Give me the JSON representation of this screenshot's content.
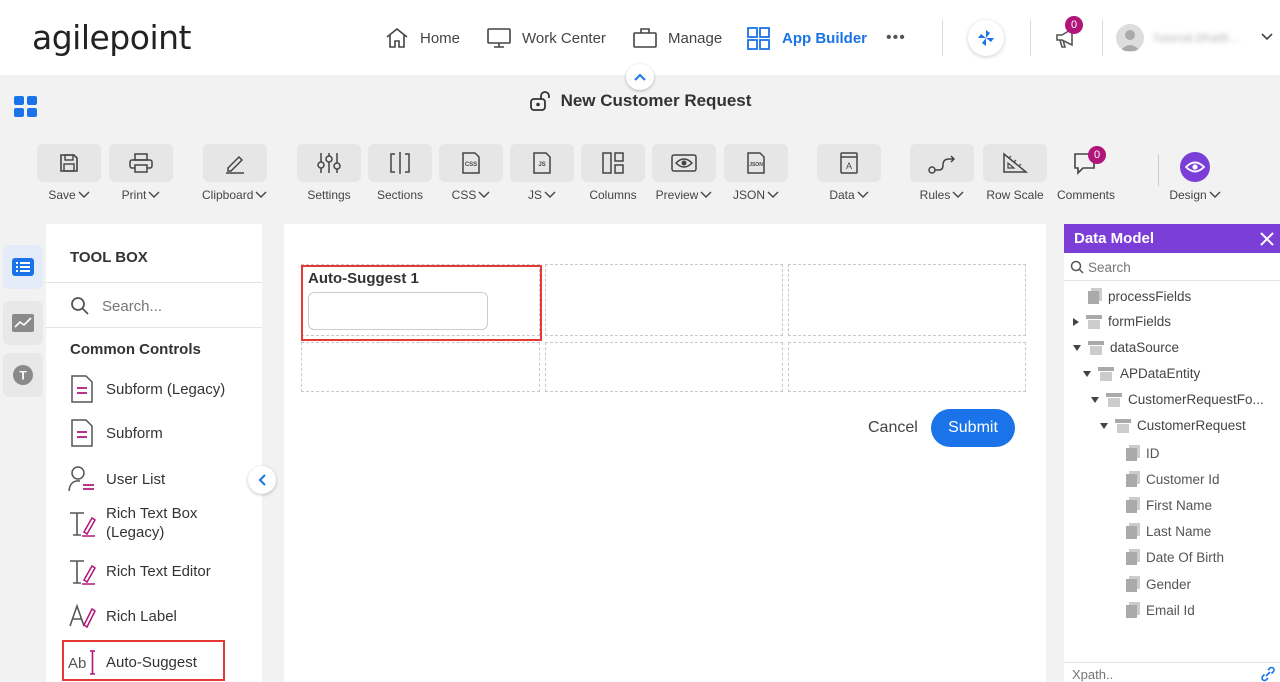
{
  "brand": {
    "logo_text": "agilepoint"
  },
  "nav": {
    "items": [
      {
        "label": "Home",
        "icon": "home-icon"
      },
      {
        "label": "Work Center",
        "icon": "monitor-icon"
      },
      {
        "label": "Manage",
        "icon": "briefcase-icon"
      },
      {
        "label": "App Builder",
        "icon": "grid-icon"
      }
    ],
    "more": "•••",
    "notifications_count": "0",
    "user_name": "hasnat.bhatti..."
  },
  "page_title": "New Customer Request",
  "toolbar": [
    {
      "label": "Save",
      "dropdown": true,
      "icon": "save-icon"
    },
    {
      "label": "Print",
      "dropdown": true,
      "icon": "printer-icon"
    },
    {
      "label": "Clipboard",
      "dropdown": true,
      "icon": "pencil-icon"
    },
    {
      "label": "Settings",
      "dropdown": false,
      "icon": "sliders-icon"
    },
    {
      "label": "Sections",
      "dropdown": false,
      "icon": "sections-icon"
    },
    {
      "label": "CSS",
      "dropdown": true,
      "icon": "css-file-icon"
    },
    {
      "label": "JS",
      "dropdown": true,
      "icon": "js-file-icon"
    },
    {
      "label": "Columns",
      "dropdown": false,
      "icon": "columns-icon"
    },
    {
      "label": "Preview",
      "dropdown": true,
      "icon": "eye-icon"
    },
    {
      "label": "JSON",
      "dropdown": true,
      "icon": "json-file-icon"
    },
    {
      "label": "Data",
      "dropdown": true,
      "icon": "data-icon"
    },
    {
      "label": "Rules",
      "dropdown": true,
      "icon": "rules-icon"
    },
    {
      "label": "Row Scale",
      "dropdown": false,
      "icon": "ruler-icon"
    },
    {
      "label": "Comments",
      "dropdown": false,
      "icon": "comment-icon",
      "badge": "0"
    },
    {
      "label": "Design",
      "dropdown": true,
      "icon": "design-eye-icon"
    }
  ],
  "toolbox": {
    "title": "TOOL BOX",
    "search_placeholder": "Search...",
    "section": "Common Controls",
    "items": [
      {
        "label": "Subform (Legacy)",
        "icon": "subform-icon"
      },
      {
        "label": "Subform",
        "icon": "subform-icon"
      },
      {
        "label": "User List",
        "icon": "user-list-icon"
      },
      {
        "label": "Rich Text Box\n(Legacy)",
        "icon": "rich-text-icon"
      },
      {
        "label": "Rich Text Editor",
        "icon": "rich-text-icon"
      },
      {
        "label": "Rich Label",
        "icon": "rich-label-icon"
      },
      {
        "label": "Auto-Suggest",
        "icon": "auto-suggest-icon"
      }
    ]
  },
  "form": {
    "field_label": "Auto-Suggest 1",
    "field_value": "",
    "cancel": "Cancel",
    "submit": "Submit"
  },
  "data_model": {
    "title": "Data Model",
    "search_placeholder": "Search",
    "xpath_placeholder": "Xpath..",
    "tree": [
      {
        "label": "processFields"
      },
      {
        "label": "formFields"
      },
      {
        "label": "dataSource"
      },
      {
        "label": "APDataEntity"
      },
      {
        "label": "CustomerRequestFo..."
      },
      {
        "label": "CustomerRequest"
      },
      {
        "label": "ID"
      },
      {
        "label": "Customer Id"
      },
      {
        "label": "First Name"
      },
      {
        "label": "Last Name"
      },
      {
        "label": "Date Of Birth"
      },
      {
        "label": "Gender"
      },
      {
        "label": "Email Id"
      }
    ]
  },
  "colors": {
    "accent": "#1a73e8",
    "purple": "#7b3fd8",
    "badge": "#b0157a",
    "highlight": "#e53935"
  }
}
